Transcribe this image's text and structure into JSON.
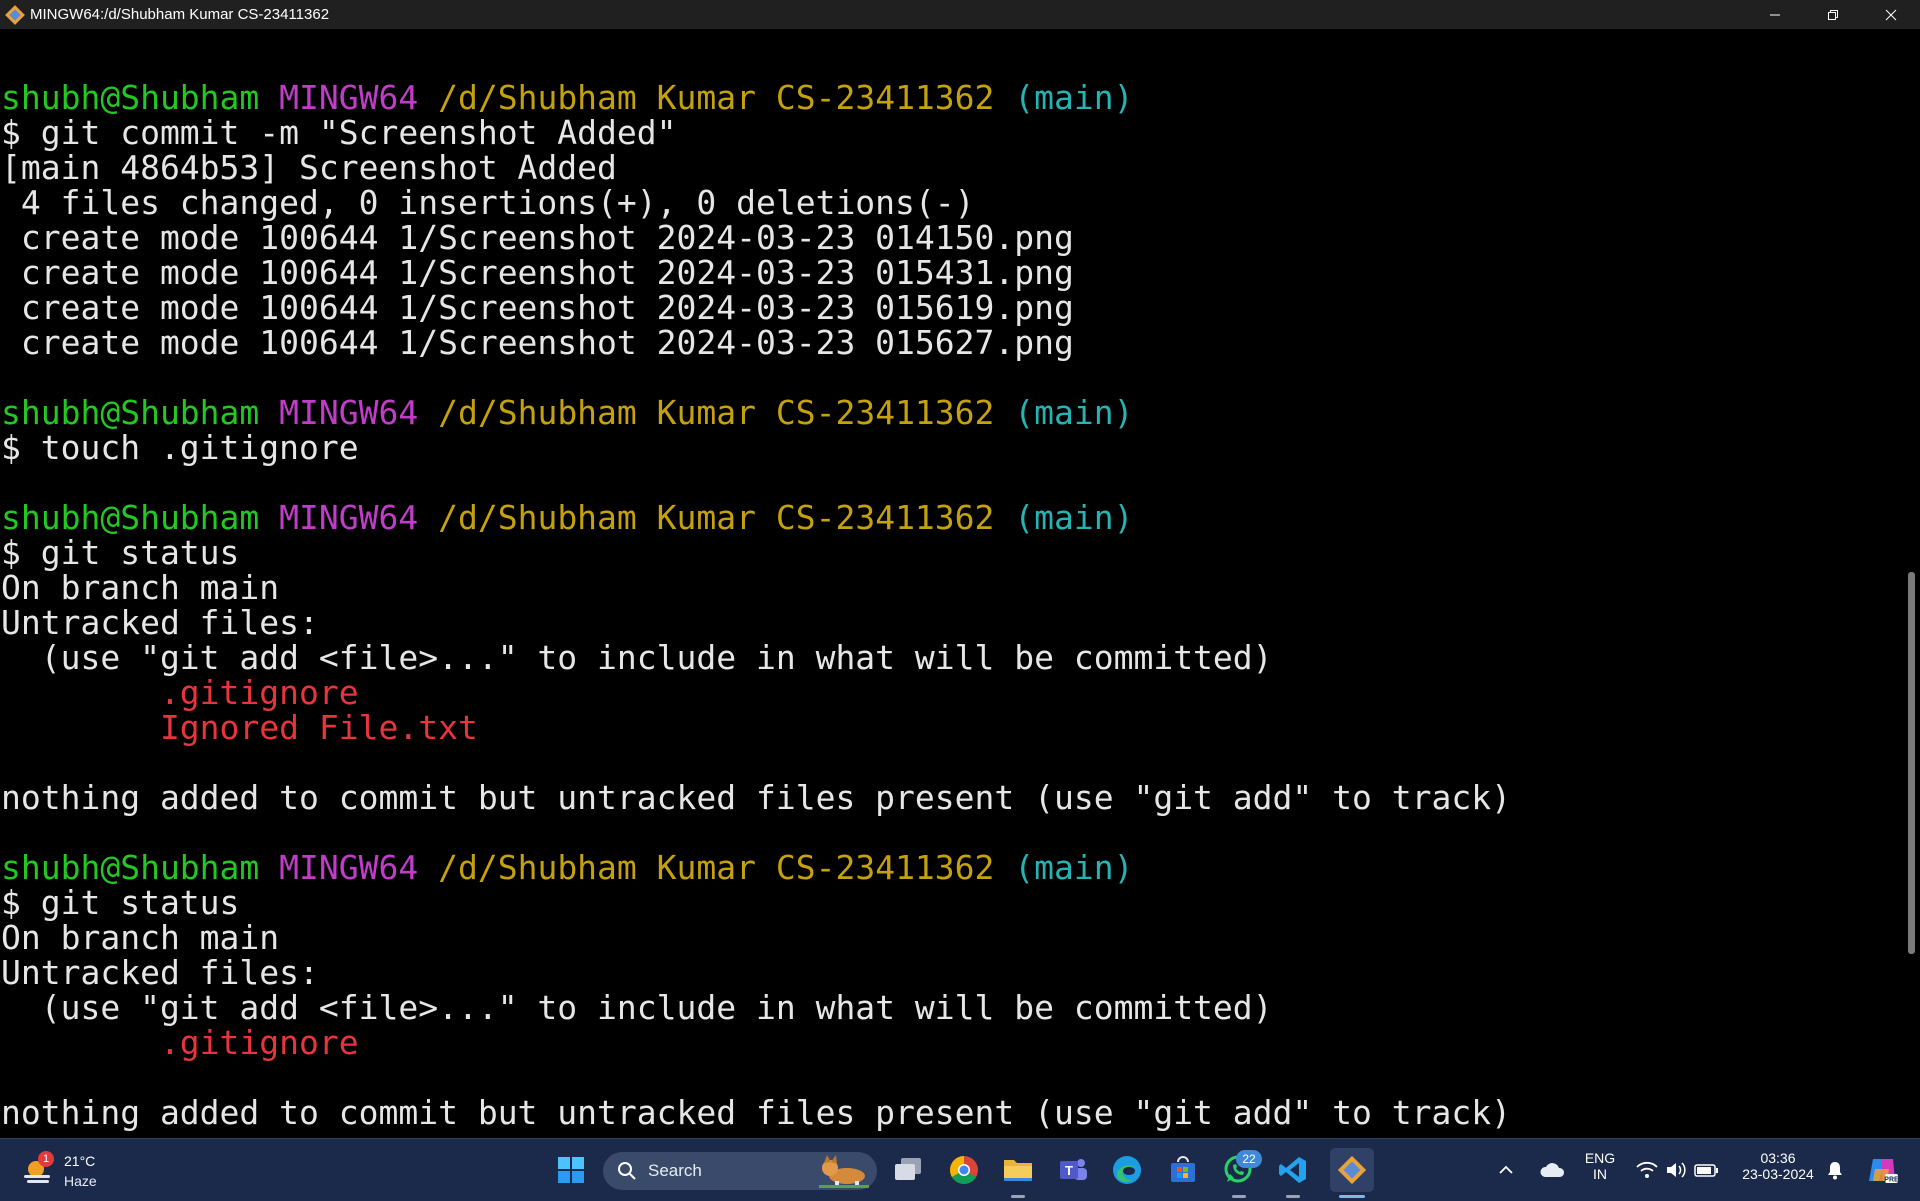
{
  "window": {
    "title": "MINGW64:/d/Shubham Kumar CS-23411362"
  },
  "terminal": {
    "prompt": {
      "user": "shubh@Shubham",
      "system": "MINGW64",
      "path": "/d/Shubham Kumar CS-23411362",
      "branch": "(main)"
    },
    "lines": [
      {
        "id": "l1",
        "kind": "prompt"
      },
      {
        "id": "l2",
        "text": "$ git commit -m \"Screenshot Added\"",
        "color": "default"
      },
      {
        "id": "l3",
        "text": "[main 4864b53] Screenshot Added",
        "color": "default"
      },
      {
        "id": "l4",
        "text": " 4 files changed, 0 insertions(+), 0 deletions(-)",
        "color": "default"
      },
      {
        "id": "l5",
        "text": " create mode 100644 1/Screenshot 2024-03-23 014150.png",
        "color": "default"
      },
      {
        "id": "l6",
        "text": " create mode 100644 1/Screenshot 2024-03-23 015431.png",
        "color": "default"
      },
      {
        "id": "l7",
        "text": " create mode 100644 1/Screenshot 2024-03-23 015619.png",
        "color": "default"
      },
      {
        "id": "l8",
        "text": " create mode 100644 1/Screenshot 2024-03-23 015627.png",
        "color": "default"
      },
      {
        "id": "l9",
        "text": "",
        "color": "default"
      },
      {
        "id": "l10",
        "kind": "prompt"
      },
      {
        "id": "l11",
        "text": "$ touch .gitignore",
        "color": "default"
      },
      {
        "id": "l12",
        "text": "",
        "color": "default"
      },
      {
        "id": "l13",
        "kind": "prompt"
      },
      {
        "id": "l14",
        "text": "$ git status",
        "color": "default"
      },
      {
        "id": "l15",
        "text": "On branch main",
        "color": "default"
      },
      {
        "id": "l16",
        "text": "Untracked files:",
        "color": "default"
      },
      {
        "id": "l17",
        "text": "  (use \"git add <file>...\" to include in what will be committed)",
        "color": "default"
      },
      {
        "id": "l18",
        "text": "        .gitignore",
        "color": "red"
      },
      {
        "id": "l19",
        "text": "        Ignored File.txt",
        "color": "red"
      },
      {
        "id": "l20",
        "text": "",
        "color": "default"
      },
      {
        "id": "l21",
        "text": "nothing added to commit but untracked files present (use \"git add\" to track)",
        "color": "default"
      },
      {
        "id": "l22",
        "text": "",
        "color": "default"
      },
      {
        "id": "l23",
        "kind": "prompt"
      },
      {
        "id": "l24",
        "text": "$ git status",
        "color": "default"
      },
      {
        "id": "l25",
        "text": "On branch main",
        "color": "default"
      },
      {
        "id": "l26",
        "text": "Untracked files:",
        "color": "default"
      },
      {
        "id": "l27",
        "text": "  (use \"git add <file>...\" to include in what will be committed)",
        "color": "default"
      },
      {
        "id": "l28",
        "text": "        .gitignore",
        "color": "red"
      },
      {
        "id": "l29",
        "text": "",
        "color": "default"
      },
      {
        "id": "l30",
        "text": "nothing added to commit but untracked files present (use \"git add\" to track)",
        "color": "default"
      }
    ]
  },
  "taskbar": {
    "weather": {
      "badge": "1",
      "temp": "21°C",
      "condition": "Haze"
    },
    "search": {
      "label": "Search"
    },
    "whatsapp_badge": "22",
    "language": {
      "line1": "ENG",
      "line2": "IN"
    },
    "clock": {
      "time": "03:36",
      "date": "23-03-2024"
    },
    "icons": [
      "windows-start-icon",
      "search-icon",
      "task-view-icon",
      "chrome-icon",
      "file-explorer-icon",
      "teams-icon",
      "edge-icon",
      "microsoft-store-icon",
      "whatsapp-icon",
      "vscode-icon",
      "git-bash-icon"
    ]
  },
  "colors": {
    "user": "#23c823",
    "system": "#c13dc9",
    "path": "#c5a10d",
    "branch": "#25b3b3",
    "untracked": "#e8343c",
    "text": "#e6e6e6",
    "background": "#000000",
    "taskbar": "#1b2a4a"
  }
}
